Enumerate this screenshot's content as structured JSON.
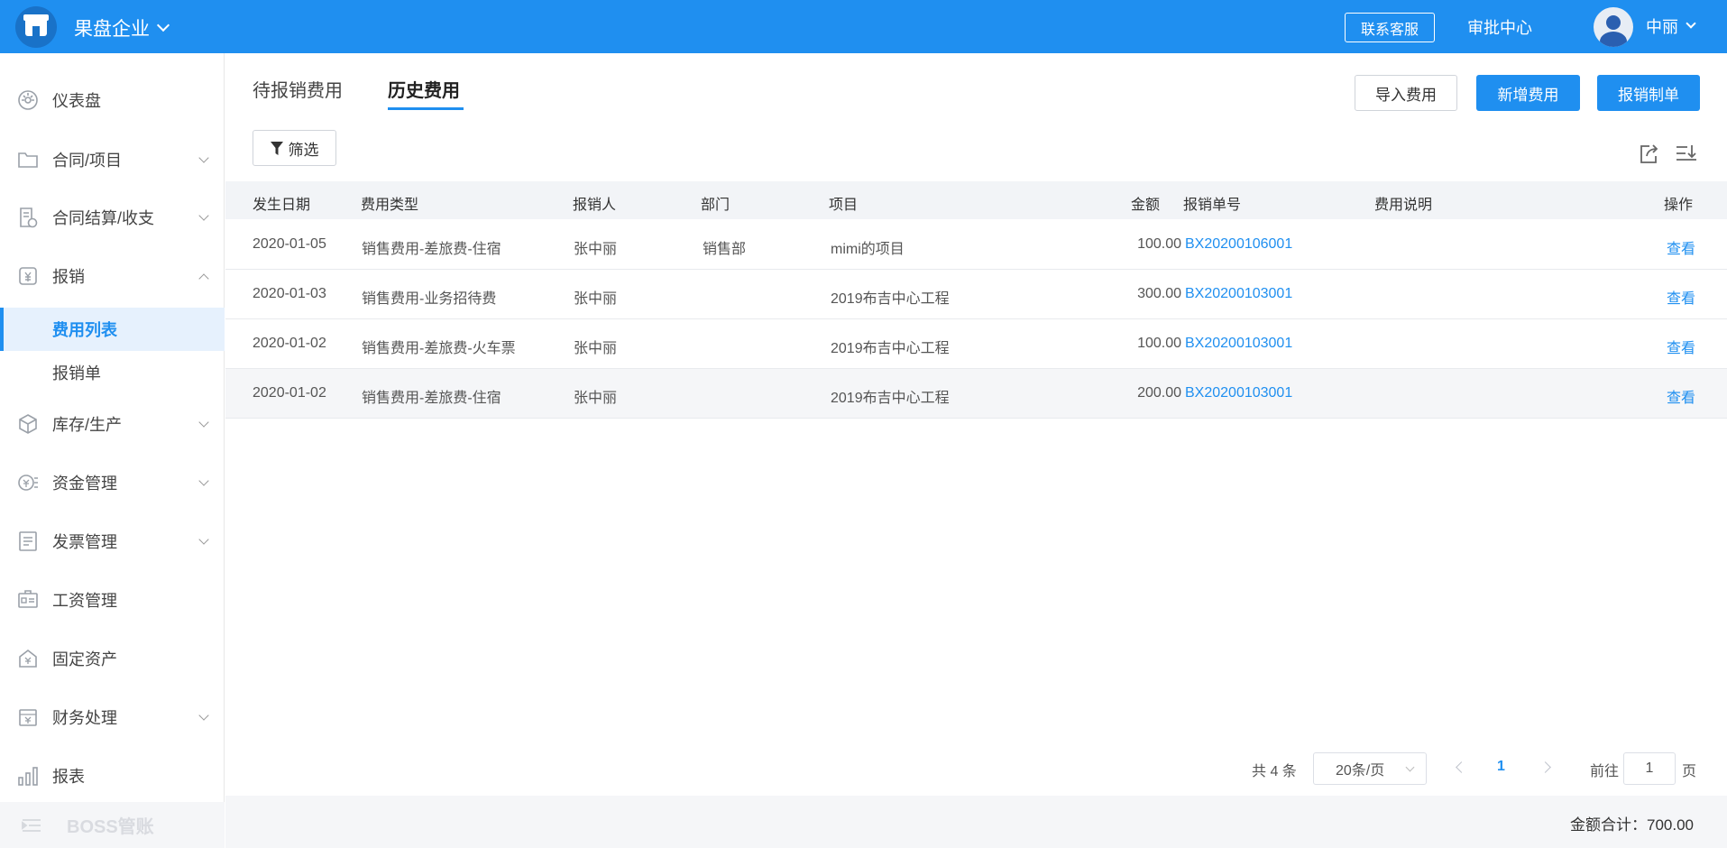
{
  "header": {
    "company": "果盘企业",
    "contact_btn": "联系客服",
    "approval": "审批中心",
    "user": "中丽"
  },
  "sidebar": {
    "items": [
      {
        "label": "仪表盘",
        "icon": "dashboard-icon"
      },
      {
        "label": "合同/项目",
        "icon": "folder-icon"
      },
      {
        "label": "合同结算/收支",
        "icon": "settlement-icon"
      },
      {
        "label": "报销",
        "icon": "reimburse-icon"
      },
      {
        "label": "库存/生产",
        "icon": "box-icon"
      },
      {
        "label": "资金管理",
        "icon": "money-icon"
      },
      {
        "label": "发票管理",
        "icon": "invoice-icon"
      },
      {
        "label": "工资管理",
        "icon": "salary-icon"
      },
      {
        "label": "固定资产",
        "icon": "asset-icon"
      },
      {
        "label": "财务处理",
        "icon": "finance-icon"
      },
      {
        "label": "报表",
        "icon": "chart-icon"
      }
    ],
    "sub_items": [
      "费用列表",
      "报销单"
    ],
    "boss": "BOSS管账"
  },
  "tabs": [
    "待报销费用",
    "历史费用"
  ],
  "buttons": {
    "import": "导入费用",
    "add": "新增费用",
    "reimburse": "报销制单",
    "filter": "筛选"
  },
  "table": {
    "headers": [
      "发生日期",
      "费用类型",
      "报销人",
      "部门",
      "项目",
      "金额",
      "报销单号",
      "费用说明",
      "操作"
    ],
    "rows": [
      {
        "date": "2020-01-05",
        "type": "销售费用-差旅费-住宿",
        "person": "张中丽",
        "dept": "销售部",
        "project": "mimi的项目",
        "amount": "100.00",
        "no": "BX20200106001",
        "note": "",
        "action": "查看"
      },
      {
        "date": "2020-01-03",
        "type": "销售费用-业务招待费",
        "person": "张中丽",
        "dept": "",
        "project": "2019布吉中心工程",
        "amount": "300.00",
        "no": "BX20200103001",
        "note": "",
        "action": "查看"
      },
      {
        "date": "2020-01-02",
        "type": "销售费用-差旅费-火车票",
        "person": "张中丽",
        "dept": "",
        "project": "2019布吉中心工程",
        "amount": "100.00",
        "no": "BX20200103001",
        "note": "",
        "action": "查看"
      },
      {
        "date": "2020-01-02",
        "type": "销售费用-差旅费-住宿",
        "person": "张中丽",
        "dept": "",
        "project": "2019布吉中心工程",
        "amount": "200.00",
        "no": "BX20200103001",
        "note": "",
        "action": "查看"
      }
    ]
  },
  "pagination": {
    "total": "共 4 条",
    "page_size": "20条/页",
    "current": "1",
    "goto": "前往",
    "goto_value": "1",
    "page_suffix": "页"
  },
  "summary": "金额合计：700.00",
  "colors": {
    "accent": "#1f8ff0",
    "header_bg": "#1f8ff0"
  }
}
